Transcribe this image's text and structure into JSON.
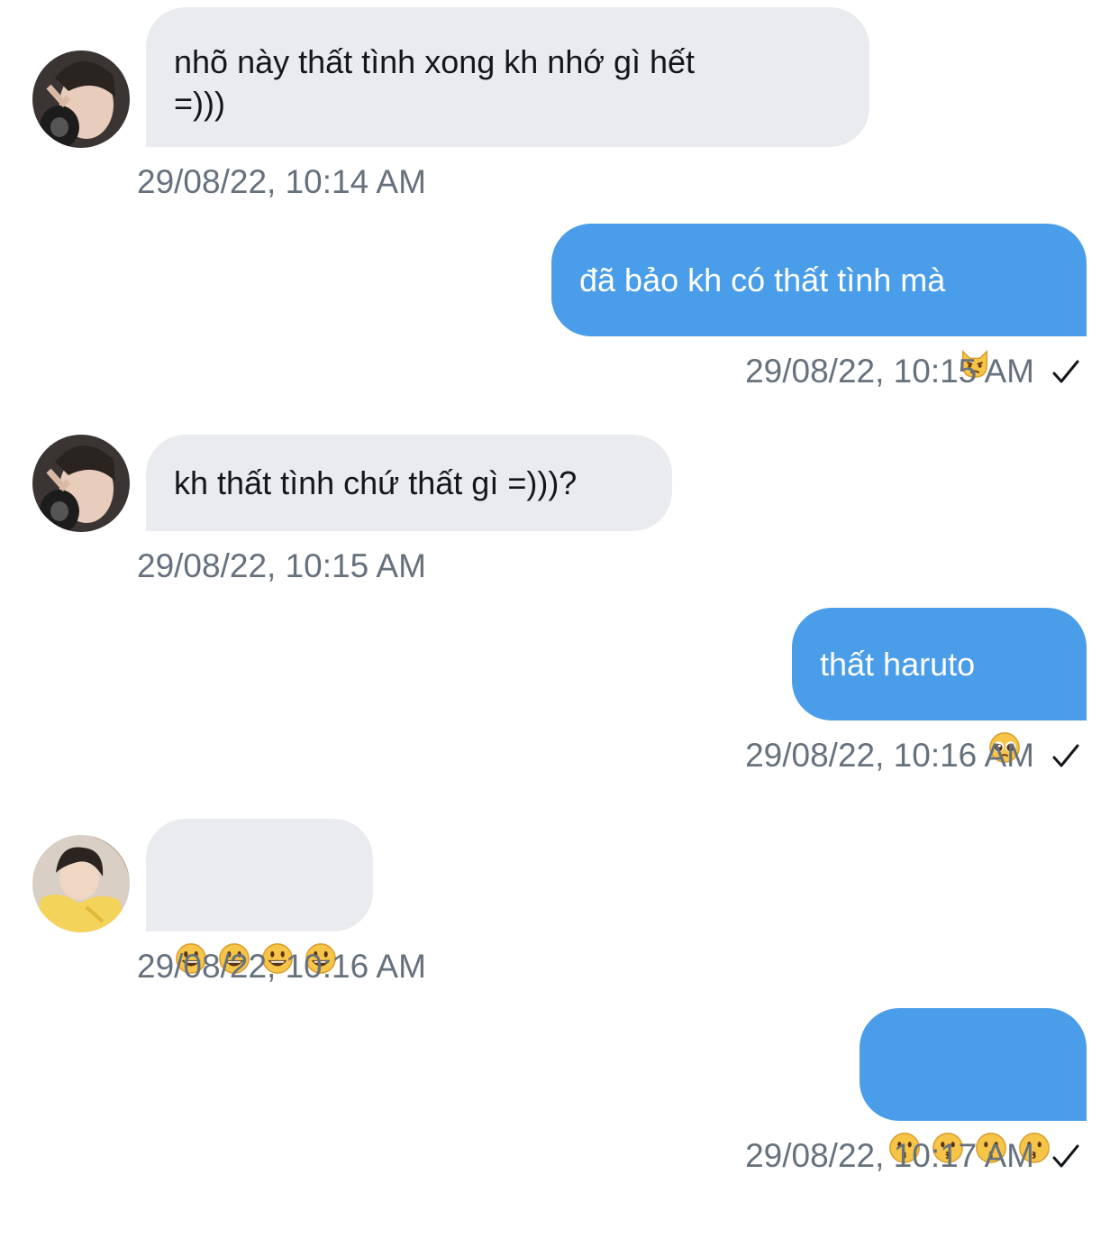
{
  "conversation": {
    "messages": [
      {
        "direction": "incoming",
        "text": "nhõ này thất tình xong kh nhớ gì hết\n=)))",
        "timestamp": "29/08/22, 10:14 AM",
        "avatar_icon": "user-avatar-photo"
      },
      {
        "direction": "outgoing",
        "text": "đã bảo kh có thất tình mà",
        "emoji": "pouting-cat-emoji",
        "timestamp": "29/08/22, 10:15 AM",
        "status_icon": "checkmark-icon"
      },
      {
        "direction": "incoming",
        "text": "kh thất tình chứ thất gì =)))?",
        "timestamp": "29/08/22, 10:15 AM",
        "avatar_icon": "user-avatar-photo"
      },
      {
        "direction": "outgoing",
        "text": "thất haruto",
        "emoji": "pleading-face-emoji",
        "timestamp": "29/08/22, 10:16 AM",
        "status_icon": "checkmark-icon"
      },
      {
        "direction": "incoming",
        "text": "",
        "emojis": [
          "grinning-face-emoji",
          "grinning-face-emoji",
          "grinning-face-emoji",
          "grinning-face-emoji"
        ],
        "timestamp": "29/08/22, 10:16 AM",
        "avatar_icon": "user-avatar-photo"
      },
      {
        "direction": "outgoing",
        "text": "",
        "emojis": [
          "kissing-face-emoji",
          "kissing-face-emoji",
          "kissing-face-emoji",
          "kissing-face-emoji"
        ],
        "timestamp": "29/08/22, 10:17 AM",
        "status_icon": "checkmark-icon"
      }
    ]
  },
  "colors": {
    "incoming_bubble": "#e9ebef",
    "outgoing_bubble": "#4a9de8",
    "timestamp": "#66717d",
    "incoming_text": "#14171a",
    "outgoing_text": "#ffffff"
  }
}
